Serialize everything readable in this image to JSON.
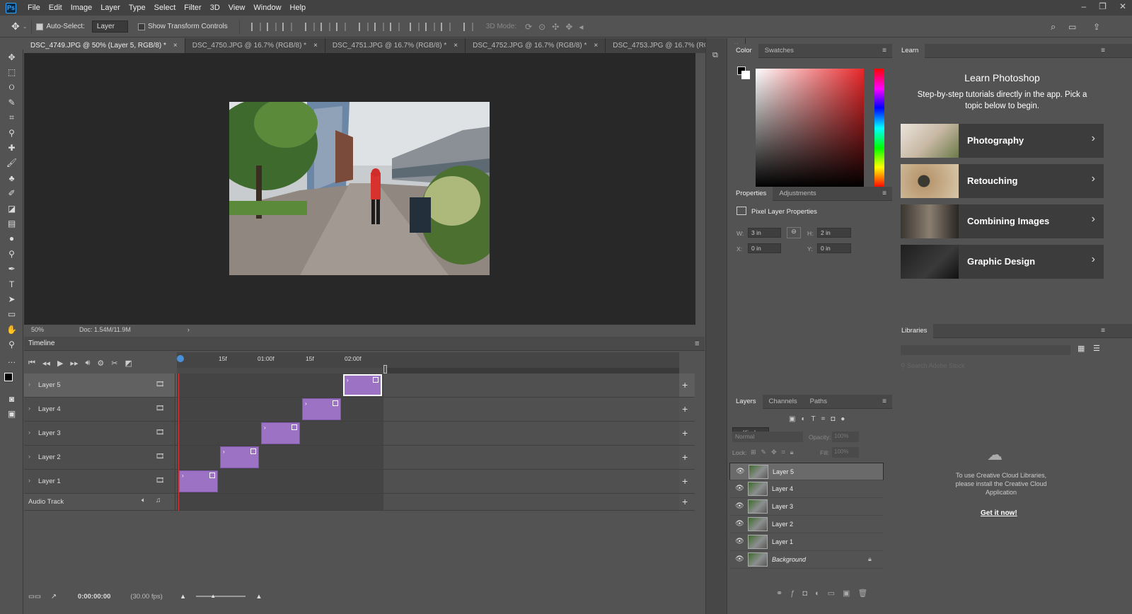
{
  "app": {
    "logo": "Ps"
  },
  "menu": [
    "File",
    "Edit",
    "Image",
    "Layer",
    "Type",
    "Select",
    "Filter",
    "3D",
    "View",
    "Window",
    "Help"
  ],
  "window_controls": [
    "–",
    "❐",
    "✕"
  ],
  "options": {
    "auto_select": "Auto-Select:",
    "auto_select_target": "Layer",
    "show_transform": "Show Transform Controls",
    "mode_3d": "3D Mode:"
  },
  "doc_tabs": [
    "DSC_4749.JPG @ 50% (Layer 5, RGB/8) *",
    "DSC_4750.JPG @ 16.7% (RGB/8) *",
    "DSC_4751.JPG @ 16.7% (RGB/8) *",
    "DSC_4752.JPG @ 16.7% (RGB/8) *",
    "DSC_4753.JPG @ 16.7% (RGB/8) *"
  ],
  "status": {
    "zoom": "50%",
    "doc": "Doc: 1.54M/11.9M"
  },
  "timeline": {
    "title": "Timeline",
    "ticks": [
      "15f",
      "01:00f",
      "15f",
      "02:00f"
    ],
    "tracks": [
      "Layer 5",
      "Layer 4",
      "Layer 3",
      "Layer 2",
      "Layer 1"
    ],
    "audio": "Audio Track",
    "timecode": "0:00:00:00",
    "fps": "(30.00 fps)"
  },
  "color_panel": {
    "tabs": [
      "Color",
      "Swatches"
    ]
  },
  "properties": {
    "tabs": [
      "Properties",
      "Adjustments"
    ],
    "title": "Pixel Layer Properties",
    "w_label": "W:",
    "w": "3 in",
    "h_label": "H:",
    "h": "2 in",
    "x_label": "X:",
    "x": "0 in",
    "y_label": "Y:",
    "y": "0 in"
  },
  "layers_panel": {
    "tabs": [
      "Layers",
      "Channels",
      "Paths"
    ],
    "kind": "Kind",
    "blend": "Normal",
    "opacity_label": "Opacity:",
    "opacity": "100%",
    "lock_label": "Lock:",
    "fill_label": "Fill:",
    "fill": "100%",
    "layers": [
      "Layer 5",
      "Layer 4",
      "Layer 3",
      "Layer 2",
      "Layer 1",
      "Background"
    ]
  },
  "learn": {
    "tab": "Learn",
    "title": "Learn Photoshop",
    "subtitle": "Step-by-step tutorials directly in the app. Pick a topic below to begin.",
    "cards": [
      "Photography",
      "Retouching",
      "Combining Images",
      "Graphic Design"
    ]
  },
  "libraries": {
    "tab": "Libraries",
    "search_placeholder": "Search Adobe Stock",
    "message": "To use Creative Cloud Libraries, please install the Creative Cloud Application",
    "link": "Get it now!"
  }
}
